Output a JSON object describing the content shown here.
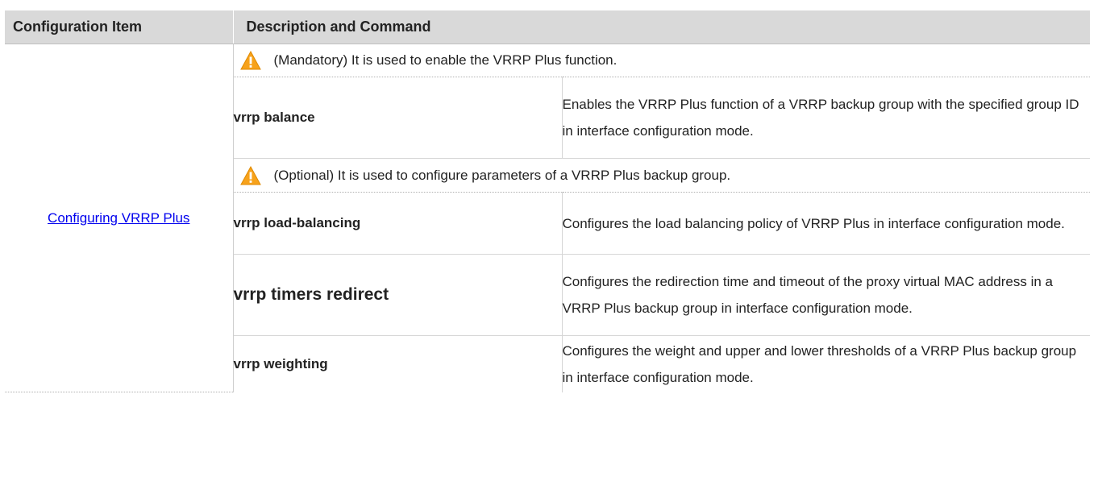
{
  "table": {
    "headers": {
      "item": "Configuration Item",
      "description": "Description and Command"
    },
    "config_item_link": "Configuring VRRP Plus",
    "sections": [
      {
        "note": "(Mandatory) It is used to enable the VRRP Plus function.",
        "commands": [
          {
            "command": "vrrp balance",
            "description": "Enables the VRRP Plus function of a VRRP backup group with the specified group ID in interface configuration mode."
          }
        ]
      },
      {
        "note": "(Optional) It is used to configure parameters of a VRRP Plus backup group.",
        "commands": [
          {
            "command": "vrrp load-balancing",
            "description": "Configures the load balancing policy of VRRP Plus in interface configuration mode."
          },
          {
            "command": "vrrp timers redirect",
            "description": "Configures the redirection time and timeout of the proxy virtual MAC address in a VRRP Plus backup group in interface configuration mode."
          },
          {
            "command": "vrrp weighting",
            "description": "Configures the weight and upper and lower thresholds of a VRRP Plus backup group in interface configuration mode."
          }
        ]
      }
    ]
  },
  "icons": {
    "warning": "warning-triangle-icon"
  },
  "colors": {
    "header_bg": "#d9d9d9",
    "link": "#0000ee",
    "warning_fill": "#f7a21b",
    "warning_mark": "#ffffff"
  }
}
